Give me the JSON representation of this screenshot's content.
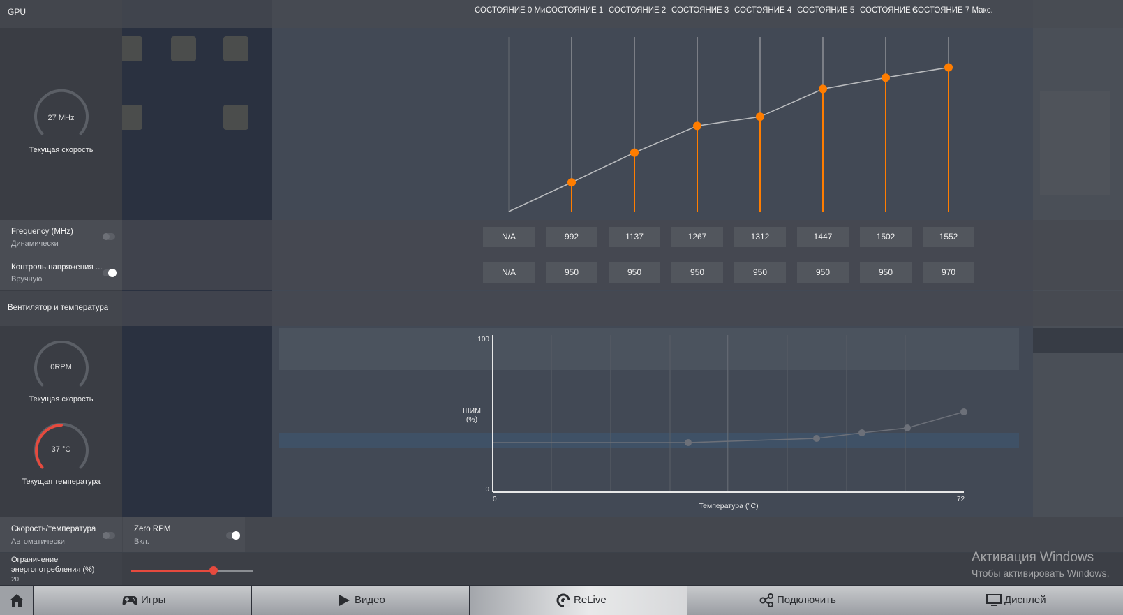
{
  "header": {
    "title": "GPU",
    "states": [
      "СОСТОЯНИЕ 0 Мин",
      "СОСТОЯНИЕ 1",
      "СОСТОЯНИЕ 2",
      "СОСТОЯНИЕ 3",
      "СОСТОЯНИЕ 4",
      "СОСТОЯНИЕ 5",
      "СОСТОЯНИЕ 6",
      "СОСТОЯНИЕ 7 Макс."
    ]
  },
  "gpu_gauge": {
    "value": "27 MHz",
    "label": "Текущая скорость"
  },
  "frequency": {
    "title": "Frequency (MHz)",
    "mode": "Динамически",
    "toggle_on": false,
    "values": [
      "N/A",
      "992",
      "1137",
      "1267",
      "1312",
      "1447",
      "1502",
      "1552"
    ]
  },
  "voltage": {
    "title": "Контроль напряжения ...",
    "mode": "Вручную",
    "toggle_on": true,
    "values": [
      "N/A",
      "950",
      "950",
      "950",
      "950",
      "950",
      "950",
      "970"
    ]
  },
  "fan_section": {
    "title": "Вентилятор и температура"
  },
  "fan_gauge": {
    "value": "0RPM",
    "label": "Текущая скорость"
  },
  "temp_gauge": {
    "value": "37 °C",
    "label": "Текущая температура",
    "fraction": 0.37
  },
  "fan_chart": {
    "ylabel_1": "ШИМ",
    "ylabel_2": "(%)",
    "ymax": "100",
    "ymin": "0",
    "xmin": "0",
    "xmax": "72",
    "xlabel": "Температура (°C)"
  },
  "speed_temp": {
    "title": "Скорость/температура",
    "mode": "Автоматически",
    "toggle_on": false
  },
  "zero_rpm": {
    "title": "Zero RPM",
    "mode": "Вкл.",
    "toggle_on": true
  },
  "power_limit": {
    "title_1": "Ограничение",
    "title_2": "энергопотребления (%)",
    "value": "20",
    "fraction": 0.68
  },
  "colors": {
    "accent": "#ff7d00",
    "red": "#e64a3e"
  },
  "tabs": [
    {
      "label": "Игры",
      "icon": "gamepad-icon"
    },
    {
      "label": "Видео",
      "icon": "play-icon"
    },
    {
      "label": "ReLive",
      "icon": "relive-icon"
    },
    {
      "label": "Подключить",
      "icon": "connect-icon"
    },
    {
      "label": "Дисплей",
      "icon": "monitor-icon"
    }
  ],
  "activation": {
    "line1": "Активация Windows",
    "line2": "Чтобы активировать Windows,"
  },
  "chart_data": {
    "type": "line",
    "categories": [
      "СОСТОЯНИЕ 0 Мин",
      "СОСТОЯНИЕ 1",
      "СОСТОЯНИЕ 2",
      "СОСТОЯНИЕ 3",
      "СОСТОЯНИЕ 4",
      "СОСТОЯНИЕ 5",
      "СОСТОЯНИЕ 6",
      "СОСТОЯНИЕ 7 Макс."
    ],
    "values": [
      null,
      992,
      1137,
      1267,
      1312,
      1447,
      1502,
      1552
    ],
    "grid": true
  }
}
